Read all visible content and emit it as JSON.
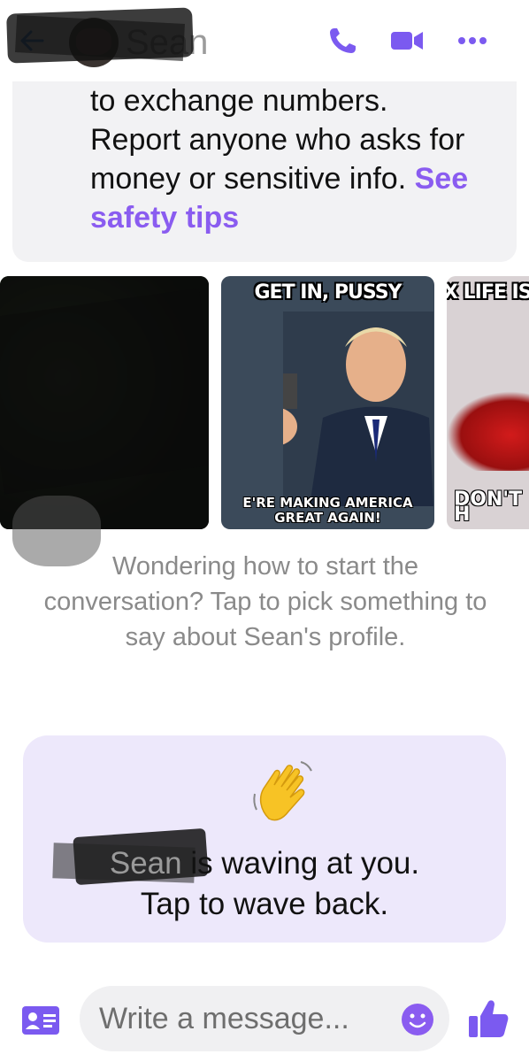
{
  "header": {
    "contact_name": "Sean",
    "icons": [
      "back-arrow-icon",
      "phone-icon",
      "video-camera-icon",
      "more-dots-icon"
    ]
  },
  "safety": {
    "text": "to exchange numbers. Report anyone who asks for money or sensitive info.",
    "link": "See safety tips"
  },
  "photos": [
    {
      "top": "",
      "bottom": ""
    },
    {
      "top": "GET IN, PUSSY",
      "bottom": "E'RE MAKING AMERICA GREAT AGAIN!"
    },
    {
      "top": "X LIFE IS",
      "bottom": "DON'T H"
    }
  ],
  "starter": {
    "text": "Wondering how to start the conversation? Tap to pick something to say about Sean's profile."
  },
  "wave": {
    "name": "Sean",
    "line1": "is waving at you.",
    "line2": "Tap to wave back."
  },
  "composer": {
    "placeholder": "Write a message..."
  },
  "colors": {
    "accent": "#8a5cf0",
    "header_icons": "#7b5af0",
    "back_arrow": "#1a73e8",
    "wave_card_bg": "#ede8fb",
    "safety_card_bg": "#f2f2f4"
  }
}
